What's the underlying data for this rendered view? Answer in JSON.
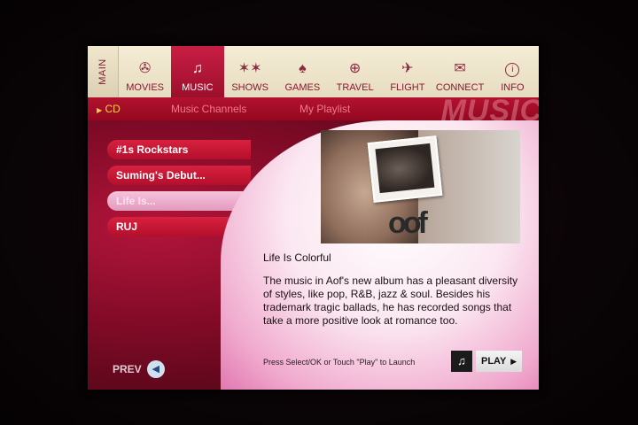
{
  "nav": {
    "main_label": "MAIN",
    "items": [
      {
        "label": "MOVIES",
        "icon": "movies-icon",
        "glyph": "✇"
      },
      {
        "label": "MUSIC",
        "icon": "music-note-icon",
        "glyph": "♫",
        "active": true
      },
      {
        "label": "SHOWS",
        "icon": "shows-stars-icon",
        "glyph": "✶✶"
      },
      {
        "label": "GAMES",
        "icon": "spade-icon",
        "glyph": "♠"
      },
      {
        "label": "TRAVEL",
        "icon": "globe-icon",
        "glyph": "⊕"
      },
      {
        "label": "FLIGHT",
        "icon": "airplane-icon",
        "glyph": "✈"
      },
      {
        "label": "CONNECT",
        "icon": "envelope-icon",
        "glyph": "✉"
      },
      {
        "label": "INFO",
        "icon": "info-icon",
        "glyph": "i"
      }
    ]
  },
  "subnav": {
    "cd": "CD",
    "cd_arrow": "▶",
    "channels": "Music Channels",
    "playlist": "My Playlist",
    "watermark": "MUSIC"
  },
  "albums": [
    "#1s Rockstars",
    "Suming's Debut...",
    "Life Is...",
    "RUJ"
  ],
  "selected_album_index": 2,
  "prev_label": "PREV",
  "prev_glyph": "◀",
  "cover_logo": "oof",
  "track_title": "Life Is Colorful",
  "description": "The music in Aof's new album has a pleasant diversity of styles, like pop, R&B, jazz & soul. Besides his trademark tragic ballads, he has recorded songs that take a more positive look at romance too.",
  "launch_hint": "Press Select/OK or Touch \"Play\" to Launch",
  "play_label": "PLAY",
  "play_note_glyph": "♫",
  "play_arrow_glyph": "▶",
  "colors": {
    "accent": "#c81e44",
    "subnav_active": "#ffd24a",
    "subnav_text": "#f07a8c"
  }
}
